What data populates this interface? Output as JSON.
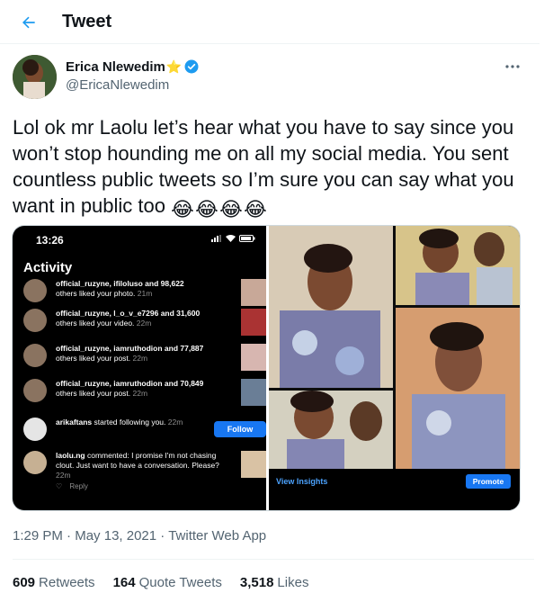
{
  "header": {
    "title": "Tweet",
    "back_icon": "arrow-left-icon"
  },
  "author": {
    "name": "Erica Nlewedim",
    "handle": "@EricaNlewedim",
    "star_emoji": "⭐",
    "verified": true,
    "accent": "#1d9bf0"
  },
  "tweet": {
    "text": "Lol ok mr Laolu let’s hear what you have to say since you won’t stop hounding me on all my social media. You sent countless public tweets so I’m sure you can say what you want in public too",
    "emojis": [
      "😂",
      "😂",
      "😂",
      "😂"
    ]
  },
  "media": {
    "screenshot": {
      "time": "13:26",
      "title": "Activity",
      "items": [
        {
          "user": "official_ruzyne, ifiloluso and 98,622",
          "action": "others liked your photo.",
          "time": "21m"
        },
        {
          "user": "official_ruzyne, l_o_v_e7296 and 31,600",
          "action": "others liked your video.",
          "time": "22m"
        },
        {
          "user": "official_ruzyne, iamruthodion and 77,887",
          "action": "others liked your post.",
          "time": "22m"
        },
        {
          "user": "official_ruzyne, iamruthodion and 70,849",
          "action": "others liked your post.",
          "time": "22m"
        },
        {
          "user": "arikaftans",
          "action": "started following you.",
          "time": "22m"
        },
        {
          "user": "laolu.ng",
          "action": "commented: I promise I'm not chasing clout. Just want to have a conversation. Please?",
          "time": "22m"
        }
      ],
      "follow_label": "Follow",
      "reply_label": "Reply"
    },
    "photos": {
      "insights_label": "View Insights",
      "promote_label": "Promote"
    }
  },
  "meta": {
    "time": "1:29 PM",
    "separator": "·",
    "date": "May 13, 2021",
    "client": "Twitter Web App"
  },
  "stats": [
    {
      "count": "609",
      "label": "Retweets"
    },
    {
      "count": "164",
      "label": "Quote Tweets"
    },
    {
      "count": "3,518",
      "label": "Likes"
    }
  ]
}
